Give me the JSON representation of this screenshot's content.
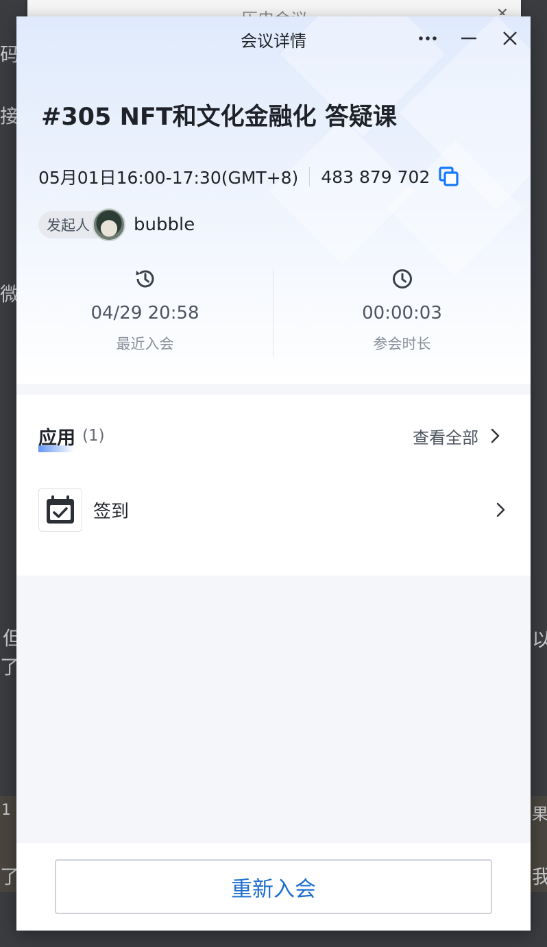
{
  "background": {
    "window_title": "历史会议",
    "close_glyph": "✕",
    "fragments": [
      "码,",
      "接",
      "微",
      "但",
      "了",
      "1",
      "了/",
      "果",
      "以",
      "我们"
    ]
  },
  "window": {
    "title": "会议详情",
    "more_icon": "more-icon",
    "minimize_icon": "minimize-icon",
    "close_icon": "close-icon"
  },
  "meeting": {
    "title": "#305 NFT和文化金融化 答疑课",
    "time": "05月01日16:00-17:30(GMT+8)",
    "meeting_id": "483 879 702",
    "host_label": "发起人",
    "host_name": "bubble"
  },
  "stats": {
    "last_join": {
      "value": "04/29 20:58",
      "label": "最近入会",
      "icon": "history-icon"
    },
    "duration": {
      "value": "00:00:03",
      "label": "参会时长",
      "icon": "clock-icon"
    }
  },
  "apps": {
    "title": "应用",
    "count": "(1)",
    "see_all": "查看全部",
    "items": [
      {
        "label": "签到",
        "icon": "check-in-calendar-icon"
      }
    ]
  },
  "footer": {
    "rejoin_label": "重新入会"
  },
  "colors": {
    "accent": "#1f6fd1",
    "copy_icon": "#1677ff",
    "page_bg": "#f5f6fa"
  }
}
